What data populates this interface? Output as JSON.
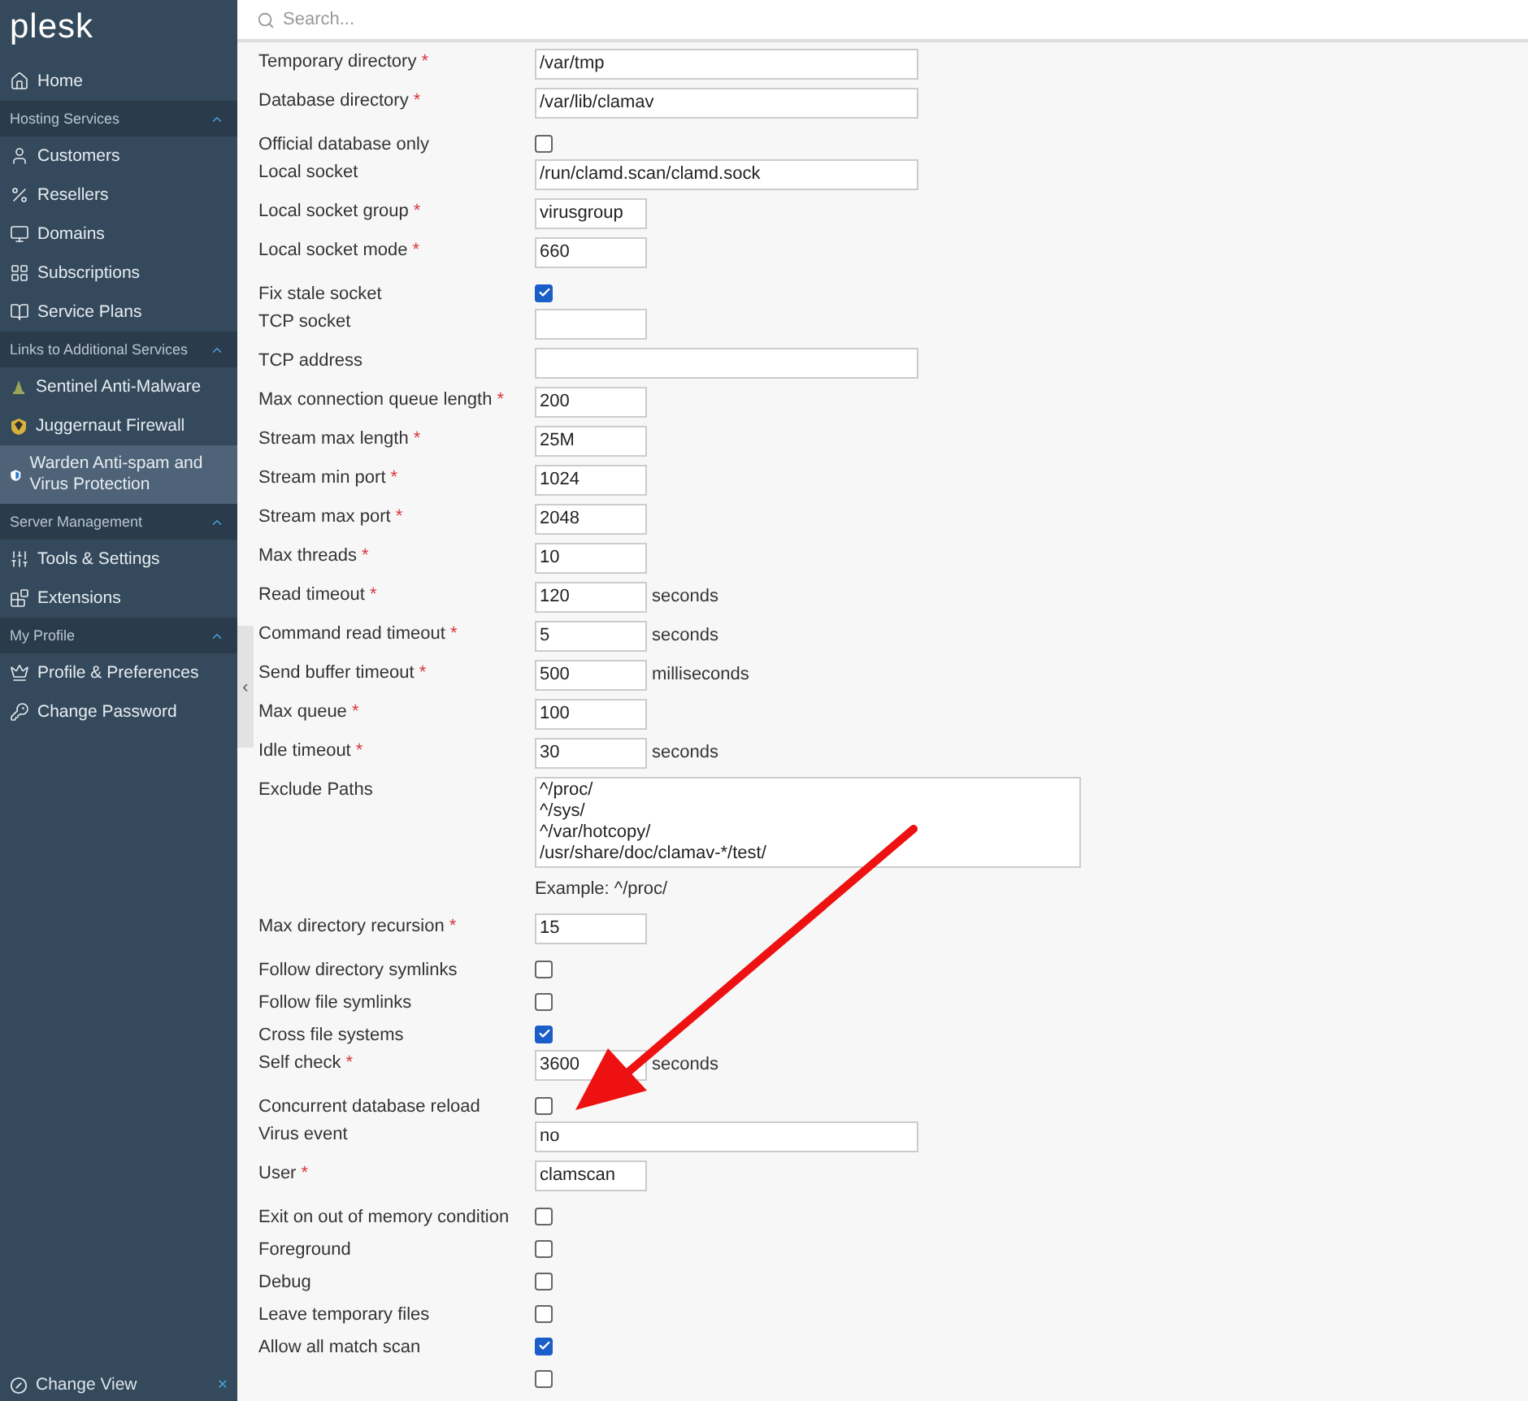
{
  "sidebar": {
    "logo": "plesk",
    "groups": [
      {
        "items": [
          {
            "label": "Home",
            "selected": false
          }
        ]
      },
      {
        "header": "Hosting Services",
        "expanded": true,
        "items": [
          {
            "label": "Customers",
            "selected": false
          },
          {
            "label": "Resellers",
            "selected": false
          },
          {
            "label": "Domains",
            "selected": false
          },
          {
            "label": "Subscriptions",
            "selected": false
          },
          {
            "label": "Service Plans",
            "selected": false
          }
        ]
      },
      {
        "header": "Links to Additional Services",
        "expanded": true,
        "items": [
          {
            "label": "Sentinel Anti-Malware",
            "selected": false
          },
          {
            "label": "Juggernaut Firewall",
            "selected": false
          },
          {
            "label": "Warden Anti-spam and Virus Protection",
            "selected": true
          }
        ]
      },
      {
        "header": "Server Management",
        "expanded": true,
        "items": [
          {
            "label": "Tools & Settings",
            "selected": false
          },
          {
            "label": "Extensions",
            "selected": false
          }
        ]
      },
      {
        "header": "My Profile",
        "expanded": true,
        "items": [
          {
            "label": "Profile & Preferences",
            "selected": false
          },
          {
            "label": "Change Password",
            "selected": false
          }
        ]
      }
    ],
    "footer": {
      "label": "Change View",
      "close": "×"
    }
  },
  "collapse_handle": "‹",
  "search": {
    "placeholder": "Search..."
  },
  "form": [
    {
      "kind": "field",
      "label": "Temporary directory",
      "mark": "*",
      "value": "/var/tmp",
      "wide": true
    },
    {
      "kind": "field",
      "label": "Database directory",
      "mark": "*",
      "value": "/var/lib/clamav",
      "wide": true
    },
    {
      "kind": "checkbox",
      "label": "Official database only",
      "checked": false
    },
    {
      "kind": "field",
      "label": "Local socket",
      "value": "/run/clamd.scan/clamd.sock",
      "wide": true
    },
    {
      "kind": "field",
      "label": "Local socket group",
      "mark": "*",
      "value": "virusgroup",
      "wide": false
    },
    {
      "kind": "field",
      "label": "Local socket mode",
      "mark": "*",
      "value": "660",
      "wide": false
    },
    {
      "kind": "checkbox",
      "label": "Fix stale socket",
      "checked": true
    },
    {
      "kind": "field",
      "label": "TCP socket",
      "wide": false
    },
    {
      "kind": "field",
      "label": "TCP address",
      "wide": true
    },
    {
      "kind": "field",
      "label": "Max connection queue length",
      "mark": "*",
      "value": "200",
      "wide": false
    },
    {
      "kind": "field",
      "label": "Stream max length",
      "mark": "*",
      "value": "25M",
      "wide": false
    },
    {
      "kind": "field",
      "label": "Stream min port",
      "mark": "*",
      "value": "1024",
      "wide": false
    },
    {
      "kind": "field",
      "label": "Stream max port",
      "mark": "*",
      "value": "2048",
      "wide": false
    },
    {
      "kind": "field",
      "label": "Max threads",
      "mark": "*",
      "value": "10",
      "wide": false
    },
    {
      "kind": "field",
      "label": "Read timeout",
      "mark": "*",
      "value": "120",
      "wide": false,
      "unit": "seconds"
    },
    {
      "kind": "field",
      "label": "Command read timeout",
      "mark": "*",
      "value": "5",
      "wide": false,
      "unit": "seconds"
    },
    {
      "kind": "field",
      "label": "Send buffer timeout",
      "mark": "*",
      "value": "500",
      "wide": false,
      "unit": "milliseconds"
    },
    {
      "kind": "field",
      "label": "Max queue",
      "mark": "*",
      "value": "100",
      "wide": false
    },
    {
      "kind": "field",
      "label": "Idle timeout",
      "mark": "*",
      "value": "30",
      "wide": false,
      "unit": "seconds"
    },
    {
      "kind": "textarea",
      "label": "Exclude Paths",
      "value": "^/proc/\n^/sys/\n^/var/hotcopy/\n/usr/share/doc/clamav-*/test/",
      "hint": "Example: ^/proc/"
    },
    {
      "kind": "field",
      "label": "Max directory recursion",
      "mark": "*",
      "value": "15",
      "wide": false
    },
    {
      "kind": "checkbox",
      "label": "Follow directory symlinks",
      "checked": false
    },
    {
      "kind": "checkbox",
      "label": "Follow file symlinks",
      "checked": false
    },
    {
      "kind": "checkbox",
      "label": "Cross file systems",
      "checked": true
    },
    {
      "kind": "field",
      "label": "Self check",
      "mark": "*",
      "value": "3600",
      "wide": false,
      "unit": "seconds"
    },
    {
      "kind": "checkbox",
      "label": "Concurrent database reload",
      "checked": false
    },
    {
      "kind": "field",
      "label": "Virus event",
      "value": "no",
      "wide": true
    },
    {
      "kind": "field",
      "label": "User",
      "mark": "*",
      "value": "clamscan",
      "wide": false
    },
    {
      "kind": "checkbox",
      "label": "Exit on out of memory condition",
      "checked": false
    },
    {
      "kind": "checkbox",
      "label": "Foreground",
      "checked": false
    },
    {
      "kind": "checkbox",
      "label": "Debug",
      "checked": false
    },
    {
      "kind": "checkbox",
      "label": "Leave temporary files",
      "checked": false
    },
    {
      "kind": "checkbox",
      "label": "Allow all match scan",
      "checked": true
    },
    {
      "kind": "checkbox",
      "checked": false
    }
  ]
}
